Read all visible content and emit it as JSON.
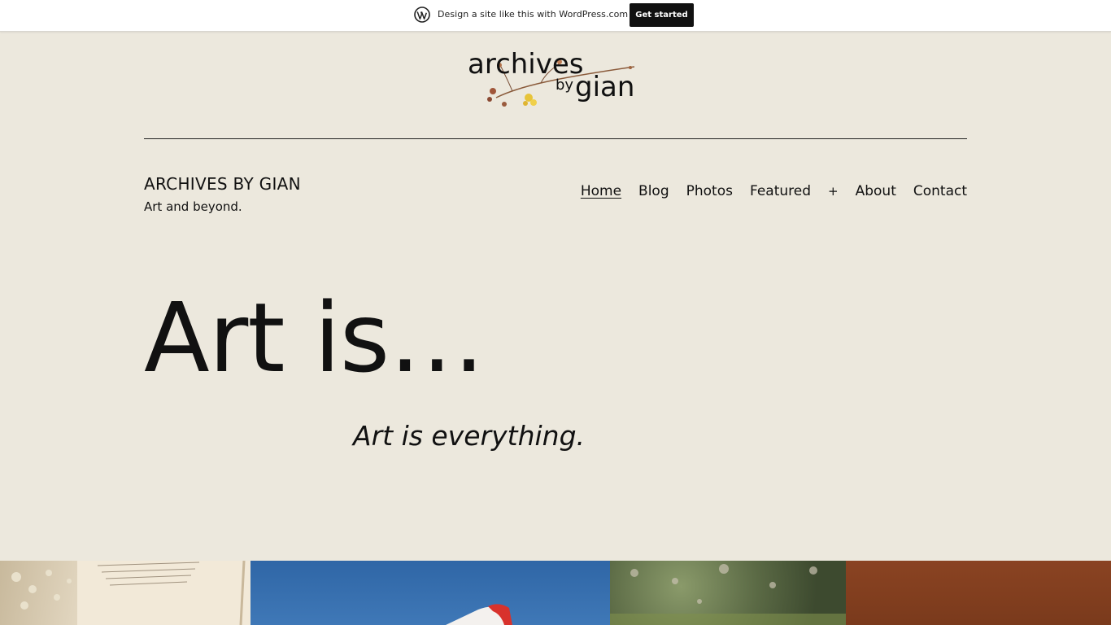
{
  "wpbar": {
    "icon": "wordpress-icon",
    "text": "Design a site like this with WordPress.com",
    "button": "Get started"
  },
  "logo": {
    "line1": "archives",
    "line2a": "by",
    "line2b": "gian"
  },
  "site": {
    "title": "ARCHIVES BY GIAN",
    "tagline": "Art and beyond."
  },
  "nav": {
    "items": [
      "Home",
      "Blog",
      "Photos",
      "Featured",
      "About",
      "Contact"
    ],
    "submenu_toggle": "+",
    "current": "Home"
  },
  "hero": {
    "title": "Art is…",
    "subtitle": "Art is everything."
  },
  "colors": {
    "background": "#ece8dd",
    "text": "#111111",
    "button": "#111111"
  }
}
